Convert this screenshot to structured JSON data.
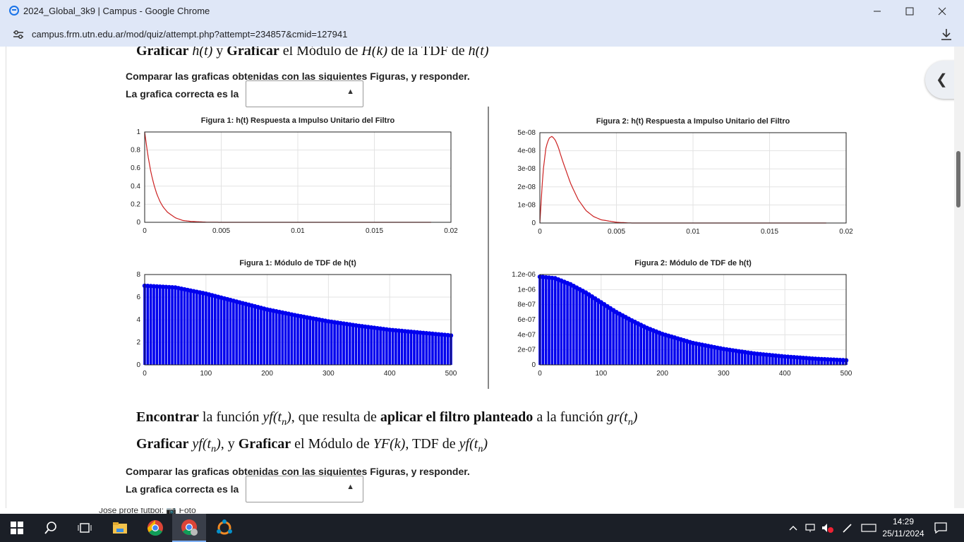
{
  "window": {
    "title": "2024_Global_3k9 | Campus - Google Chrome",
    "url": "campus.frm.utn.edu.ar/mod/quiz/attempt.php?attempt=234857&cmid=127941"
  },
  "section1": {
    "heading": {
      "b1": "Graficar",
      "m1": "h(t)",
      "t1": " y ",
      "b2": "Graficar",
      "t2": " el Módulo de ",
      "m2": "H(k)",
      "t3": " de la TDF de ",
      "m3": "h(t)"
    },
    "instruction": "Comparar las graficas obtenidas con las siguientes Figuras, y responder.",
    "answer_label": "La grafica correcta es la",
    "select_value": ""
  },
  "section2": {
    "line1": {
      "b1": "Encontrar",
      "t1": " la función ",
      "m1": "yf(t",
      "s1": "n",
      "p1": ")",
      "t2": ", que resulta de ",
      "b2": "aplicar el filtro planteado",
      "t3": " a la función ",
      "m2": "gr(t",
      "s2": "n",
      "p2": ")"
    },
    "line2": {
      "b1": "Graficar",
      "m1": "yf(t",
      "s1": "n",
      "p1": ")",
      "t1": ", y ",
      "b2": "Graficar",
      "t2": " el Módulo de ",
      "m2": "YF(k)",
      "t3": ", TDF de ",
      "m3": "yf(t",
      "s3": "n",
      "p3": ")"
    },
    "instruction": "Comparar las graficas obtenidas con las siguientes Figuras, y responder.",
    "answer_label": "La grafica correcta es la",
    "select_value": ""
  },
  "chart_data": [
    {
      "type": "line",
      "title": "Figura 1: h(t) Respuesta a Impulso Unitario del Filtro",
      "xlabel": "",
      "ylabel": "",
      "xlim": [
        0,
        0.02
      ],
      "ylim": [
        0,
        1
      ],
      "x_ticks": [
        "0",
        "0.005",
        "0.01",
        "0.015",
        "0.02"
      ],
      "y_ticks": [
        "0",
        "0.2",
        "0.4",
        "0.6",
        "0.8",
        "1"
      ],
      "grid": true,
      "color": "#cc2222",
      "x": [
        0,
        0.0002,
        0.0004,
        0.0006,
        0.0008,
        0.001,
        0.0012,
        0.0015,
        0.002,
        0.0025,
        0.003,
        0.004,
        0.005,
        0.01,
        0.015,
        0.0187
      ],
      "y": [
        1.0,
        0.75,
        0.56,
        0.42,
        0.31,
        0.23,
        0.17,
        0.11,
        0.05,
        0.02,
        0.01,
        0.002,
        0,
        0,
        0,
        0
      ]
    },
    {
      "type": "line",
      "title": "Figura 2: h(t) Respuesta a Impulso Unitario del Filtro",
      "xlabel": "",
      "ylabel": "",
      "xlim": [
        0,
        0.02
      ],
      "ylim": [
        0,
        5e-08
      ],
      "x_ticks": [
        "0",
        "0.005",
        "0.01",
        "0.015",
        "0.02"
      ],
      "y_ticks": [
        "0",
        "1e-08",
        "2e-08",
        "3e-08",
        "4e-08",
        "5e-08"
      ],
      "grid": true,
      "color": "#cc2222",
      "x": [
        0,
        0.0002,
        0.0004,
        0.0006,
        0.0008,
        0.001,
        0.0012,
        0.0015,
        0.002,
        0.0025,
        0.003,
        0.0035,
        0.004,
        0.005,
        0.006,
        0.01,
        0.015,
        0.0187
      ],
      "y": [
        0,
        2.8e-08,
        4.2e-08,
        4.7e-08,
        4.8e-08,
        4.6e-08,
        4.2e-08,
        3.4e-08,
        2.2e-08,
        1.3e-08,
        7e-09,
        3.6e-09,
        1.8e-09,
        4e-10,
        0,
        0,
        0,
        0
      ]
    },
    {
      "type": "bar",
      "title": "Figura 1: Módulo de TDF de h(t)",
      "xlabel": "",
      "ylabel": "",
      "xlim": [
        0,
        500
      ],
      "ylim": [
        0,
        8
      ],
      "x_ticks": [
        "0",
        "100",
        "200",
        "300",
        "400",
        "500"
      ],
      "y_ticks": [
        "0",
        "2",
        "4",
        "6",
        "8"
      ],
      "grid": true,
      "color": "#0000ee",
      "x": [
        0,
        50,
        100,
        150,
        200,
        250,
        300,
        350,
        400,
        450,
        500
      ],
      "y": [
        7.0,
        6.85,
        6.3,
        5.6,
        4.9,
        4.35,
        3.85,
        3.45,
        3.1,
        2.85,
        2.6
      ]
    },
    {
      "type": "bar",
      "title": "Figura 2: Módulo de TDF de h(t)",
      "xlabel": "",
      "ylabel": "",
      "xlim": [
        0,
        500
      ],
      "ylim": [
        0,
        1.2e-06
      ],
      "x_ticks": [
        "0",
        "100",
        "200",
        "300",
        "400",
        "500"
      ],
      "y_ticks": [
        "0",
        "2e-07",
        "4e-07",
        "6e-07",
        "8e-07",
        "1e-06",
        "1.2e-06"
      ],
      "grid": true,
      "color": "#0000ee",
      "x": [
        0,
        25,
        50,
        75,
        100,
        125,
        150,
        175,
        200,
        250,
        300,
        350,
        400,
        450,
        500
      ],
      "y": [
        1.17e-06,
        1.15e-06,
        1.07e-06,
        9.6e-07,
        8.3e-07,
        7e-07,
        5.9e-07,
        4.9e-07,
        4.1e-07,
        2.9e-07,
        2.1e-07,
        1.5e-07,
        1.1e-07,
        8e-08,
        6e-08
      ]
    }
  ],
  "taskbar": {
    "time": "14:29",
    "date": "25/11/2024"
  },
  "peek_text": "Jose profe fútbol: 📷 Foto",
  "colors": {
    "chrome_bg": "#dfe7f7",
    "taskbar_bg": "#1b1f27",
    "line_color": "#cc2222",
    "bar_color": "#0000ee"
  }
}
